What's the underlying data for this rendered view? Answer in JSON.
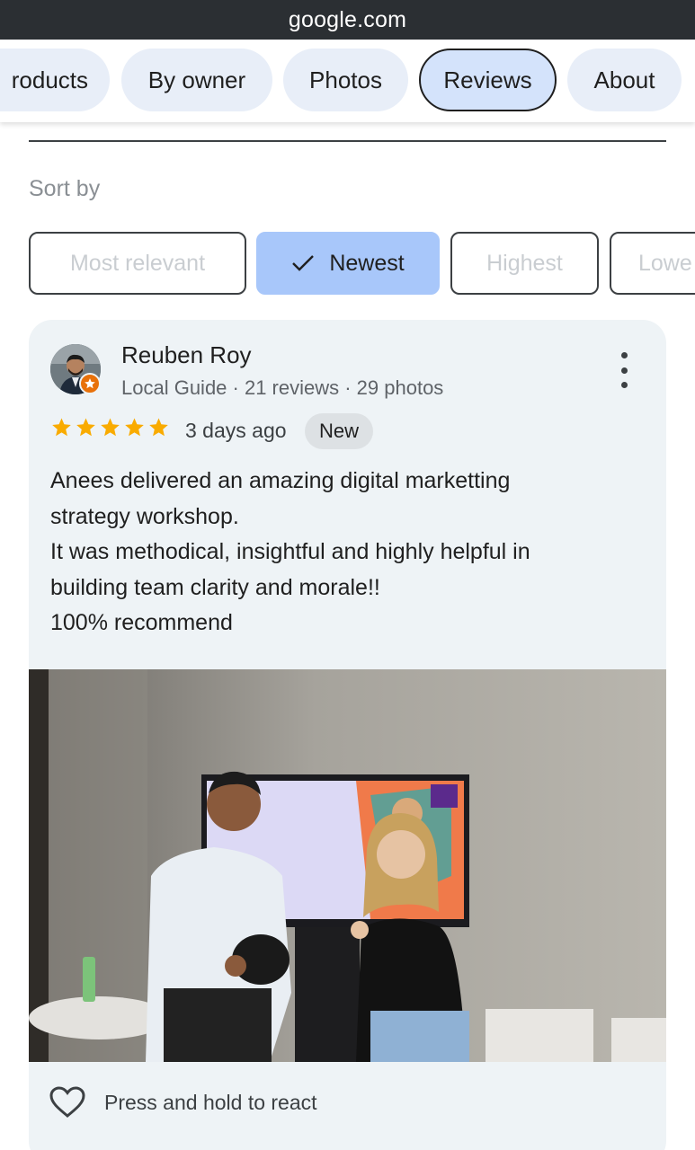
{
  "browser": {
    "url": "google.com"
  },
  "tabs": [
    {
      "label": "roducts"
    },
    {
      "label": "By owner"
    },
    {
      "label": "Photos"
    },
    {
      "label": "Reviews",
      "active": true
    },
    {
      "label": "About"
    }
  ],
  "sort": {
    "label": "Sort by",
    "options": [
      {
        "label": "Most relevant",
        "selected": false
      },
      {
        "label": "Newest",
        "selected": true
      },
      {
        "label": "Highest",
        "selected": false
      },
      {
        "label": "Lowe",
        "selected": false
      }
    ]
  },
  "review": {
    "author": "Reuben Roy",
    "meta": "Local Guide · 21 reviews · 29 photos",
    "rating": 5,
    "time": "3 days ago",
    "badge": "New",
    "text": [
      "Anees delivered an amazing digital marketting",
      "strategy workshop.",
      "It was methodical, insightful and highly helpful in",
      "building team clarity and morale!!",
      "100% recommend"
    ],
    "react_label": "Press and hold to react"
  },
  "icons": {
    "check": "check-icon",
    "more": "more-vert-icon",
    "star": "star-icon",
    "heart": "heart-outline-icon",
    "guide": "local-guide-badge-icon"
  },
  "colors": {
    "accent_chip": "#a8c7fa",
    "tab_bg": "#e8eef8",
    "active_tab_bg": "#d4e3fb",
    "star": "#f9ab00",
    "card_bg": "#eef3f6"
  }
}
